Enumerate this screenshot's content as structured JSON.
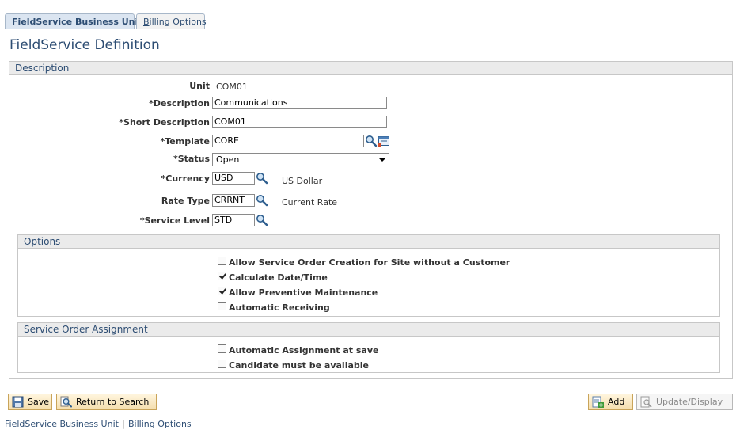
{
  "tabs": [
    {
      "label": "FieldService Business Unit",
      "active": true
    },
    {
      "label_first": "B",
      "label_rest": "illing Options",
      "active": false
    }
  ],
  "page_title": "FieldService Definition",
  "description_section": {
    "title": "Description",
    "unit_label": "Unit",
    "unit_value": "COM01",
    "description_label": "*Description",
    "description_value": "Communications",
    "short_description_label": "*Short Description",
    "short_description_value": "COM01",
    "template_label": "*Template",
    "template_value": "CORE",
    "status_label": "*Status",
    "status_value": "Open",
    "currency_label": "*Currency",
    "currency_value": "USD",
    "currency_desc": "US Dollar",
    "rate_type_label": "Rate Type",
    "rate_type_value": "CRRNT",
    "rate_type_desc": "Current Rate",
    "service_level_label": "*Service Level",
    "service_level_value": "STD"
  },
  "options_section": {
    "title": "Options",
    "items": [
      {
        "label": "Allow Service Order Creation for Site without a Customer",
        "checked": false
      },
      {
        "label": "Calculate Date/Time",
        "checked": true
      },
      {
        "label": "Allow Preventive Maintenance",
        "checked": true
      },
      {
        "label": "Automatic Receiving",
        "checked": false
      }
    ]
  },
  "assignment_section": {
    "title": "Service Order Assignment",
    "items": [
      {
        "label": "Automatic Assignment at save",
        "checked": false
      },
      {
        "label": "Candidate must be available",
        "checked": false
      }
    ]
  },
  "toolbar": {
    "save_label": "Save",
    "return_label": "Return to Search",
    "add_label": "Add",
    "update_label": "Update/Display"
  },
  "footer": {
    "link1": "FieldService Business Unit",
    "separator": "|",
    "link2": "Billing Options"
  },
  "colors": {
    "accent": "#2d4d73",
    "tab_active_bg": "#dbe5f1",
    "group_header_bg": "#ebebeb",
    "button_bg": "#f4deae"
  }
}
